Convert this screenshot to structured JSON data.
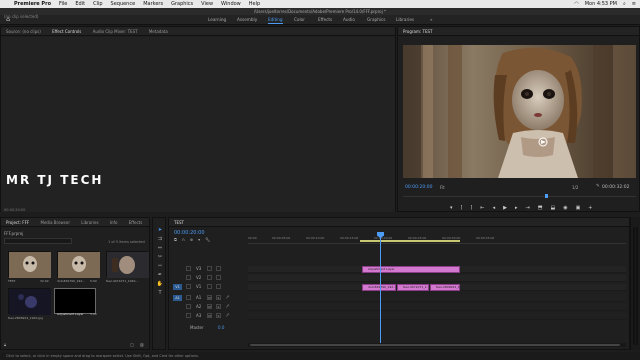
{
  "menubar": {
    "items": [
      "Premiere Pro",
      "File",
      "Edit",
      "Clip",
      "Sequence",
      "Markers",
      "Graphics",
      "View",
      "Window",
      "Help"
    ],
    "clock": "Mon 4:53 PM"
  },
  "window": {
    "path": "/Users/joeltorres/Documents/Adobe/Premiere Pro/14.0/FFF.prproj *"
  },
  "workspaces": [
    "Learning",
    "Assembly",
    "Editing",
    "Color",
    "Effects",
    "Audio",
    "Graphics",
    "Libraries"
  ],
  "source_panel": {
    "tabs": [
      "Source: (no clips)",
      "Effect Controls",
      "Audio Clip Mixer: TEST",
      "Metadata"
    ],
    "no_clip": "(no clip selected)",
    "timecode": "00:00:20:00"
  },
  "overlay": {
    "watermark": "MR TJ TECH"
  },
  "program": {
    "title": "Program: TEST",
    "tc_left": "00:00:20:00",
    "fit": "Fit",
    "quality": "1/2",
    "tc_right": "00:00:32:02"
  },
  "project": {
    "tabs": [
      "Project: FFF",
      "Media Browser",
      "Libraries",
      "Info",
      "Effects"
    ],
    "path": "FFF.prproj",
    "count": "1 of 5 items selected",
    "items": [
      {
        "label": "TEST",
        "dur": "32:02"
      },
      {
        "label": "doll-829790_192...",
        "dur": "5:00"
      },
      {
        "label": "fear-4471071_1920...",
        "dur": "5:00"
      },
      {
        "label": "fear-2806924_1920.jpg",
        "dur": "5:00"
      },
      {
        "label": "Adjustment Layer",
        "dur": "5:00"
      }
    ]
  },
  "timeline": {
    "title": "TEST",
    "timecode": "00:00:20:00",
    "ruler": [
      "00:00",
      "00:00:05:00",
      "00:00:10:00",
      "00:00:15:00",
      "00:00:20:00",
      "00:00:25:00",
      "00:00:30:00",
      "00:00:35:00"
    ],
    "tracks": [
      {
        "name": "V3"
      },
      {
        "name": "V2"
      },
      {
        "name": "V1"
      },
      {
        "name": "A1"
      },
      {
        "name": "A2"
      },
      {
        "name": "A3"
      }
    ],
    "master": {
      "label": "Master",
      "value": "0.0"
    },
    "clips": {
      "adjustment": "Adjustment Layer",
      "v1_a": "doll-829790_192...",
      "v1_b": "fear-4471071_1...",
      "v1_c": "fear-2806924_1..."
    }
  },
  "status": "Click to select, or click in empty space and drag to marquee select. Use Shift, Opt, and Cmd for other options."
}
